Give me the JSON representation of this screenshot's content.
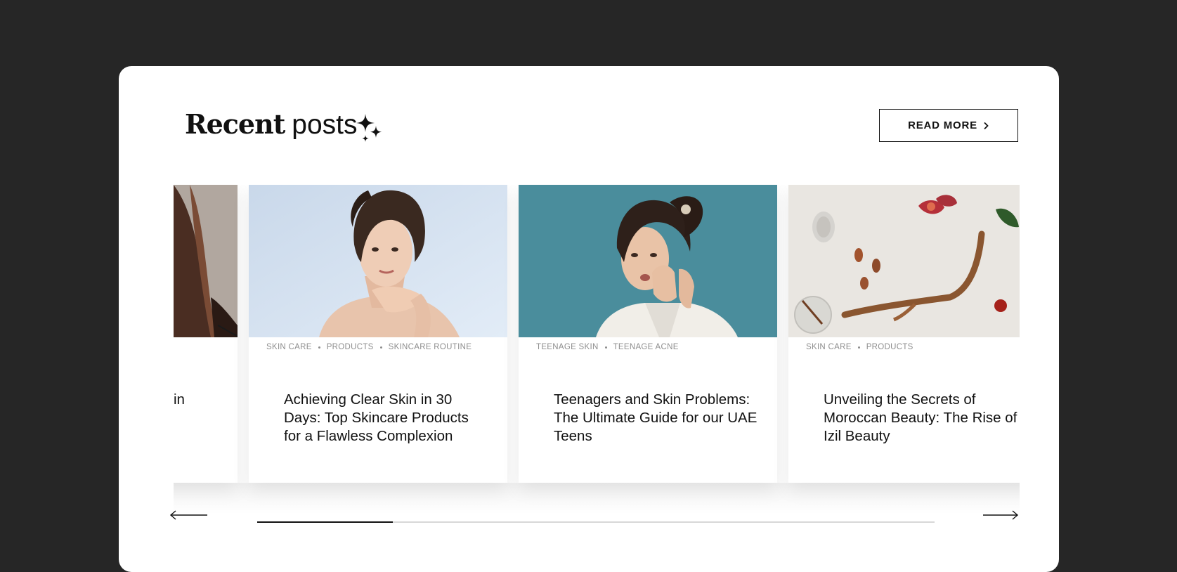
{
  "colors": {
    "page_background": "#262626",
    "panel_background": "#ffffff",
    "text": "#111111",
    "tag_text": "#8e8e8e",
    "track": "#d8d8d8",
    "track_fill": "#111111"
  },
  "header": {
    "title_strong": "Recent",
    "title_light": "posts",
    "title_icon": "sparkles-icon",
    "read_more_label": "READ MORE",
    "read_more_icon": "chevron-right-icon"
  },
  "carousel": {
    "prev_icon": "arrow-left-icon",
    "next_icon": "arrow-right-icon",
    "progress": 0.2,
    "cards": [
      {
        "image": "woman-dark-hair-photo",
        "tags": [],
        "title": "in"
      },
      {
        "image": "woman-touching-chin-photo",
        "tags": [
          "SKIN CARE",
          "PRODUCTS",
          "SKINCARE ROUTINE"
        ],
        "title": "Achieving Clear Skin in 30 Days: Top Skincare Products for a Flawless Complexion"
      },
      {
        "image": "teen-checking-skin-photo",
        "tags": [
          "TEENAGE SKIN",
          "TEENAGE ACNE"
        ],
        "title": "Teenagers and Skin Problems: The Ultimate Guide for our UAE Teens"
      },
      {
        "image": "moroccan-ingredients-photo",
        "tags": [
          "SKIN CARE",
          "PRODUCTS"
        ],
        "title": "Unveiling the Secrets of Moroccan Beauty: The Rise of Izil Beauty"
      }
    ]
  }
}
